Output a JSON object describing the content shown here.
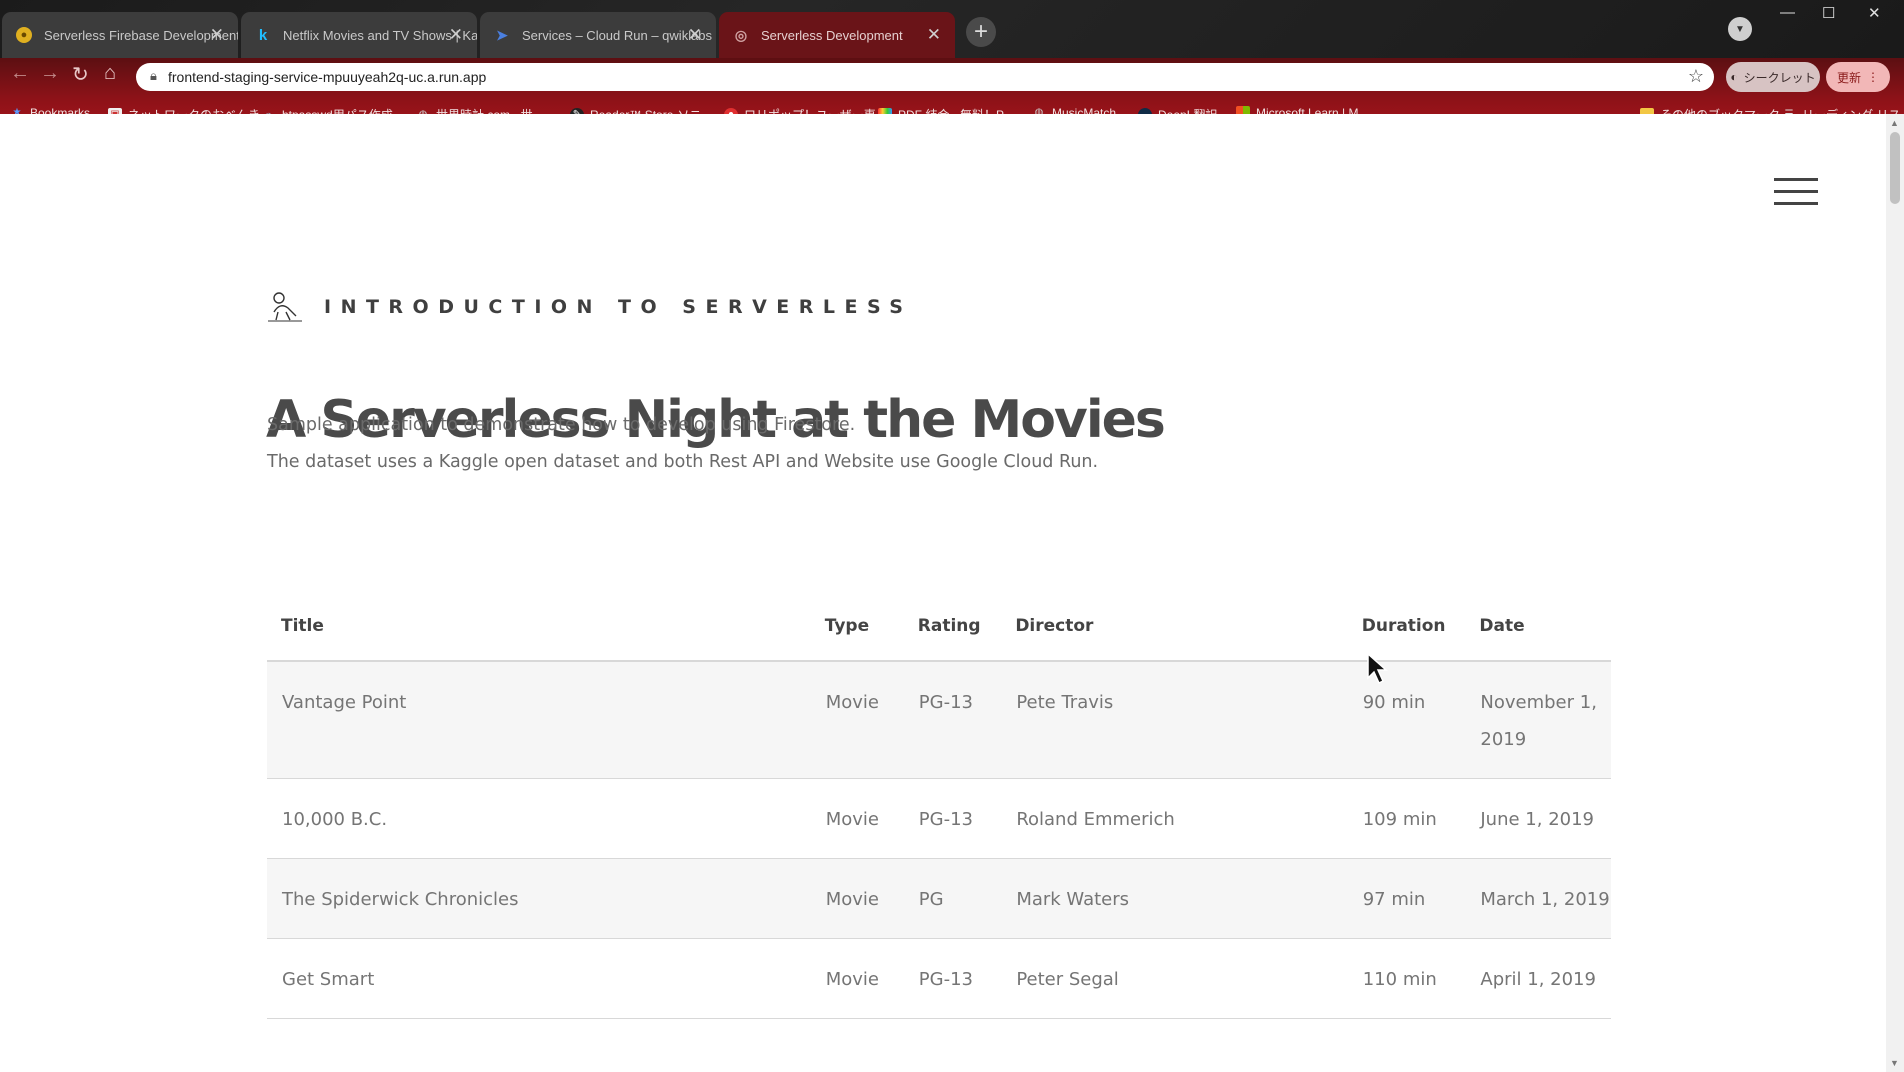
{
  "browser": {
    "tabs": [
      {
        "title": "Serverless Firebase Development",
        "favicon": "firebase-icon",
        "active": false
      },
      {
        "title": "Netflix Movies and TV Shows | Kaggle",
        "favicon": "kaggle-icon",
        "active": false
      },
      {
        "title": "Services – Cloud Run – qwiklabs",
        "favicon": "cloud-run-icon",
        "active": false
      },
      {
        "title": "Serverless Development",
        "favicon": "globe-icon",
        "active": true
      }
    ],
    "url": "frontend-staging-service-mpuuyeah2q-uc.a.run.app",
    "incognito_label": "シークレット",
    "update_label": "更新",
    "bookmarks": [
      "Bookmarks",
      "ネットワークのおべんき...",
      "htpasswd用パス作成...",
      "世界時計.com - 世...",
      "Reader™ Store-ソニ...",
      "ロリポップ！ユーザー専...",
      "PDF 結合 - 無料！P...",
      "MusicMatch",
      "DeepL翻訳",
      "Microsoft Learn | M..."
    ],
    "bookmarks_right": [
      "その他のブックマーク",
      "リーディング リスト"
    ]
  },
  "page": {
    "brand": "INTRODUCTION TO SERVERLESS",
    "title": "A Serverless Night at the Movies",
    "desc1": "Sample application to demonstrate how to develop using Firestore.",
    "desc2": "The dataset uses a Kaggle open dataset and both Rest API and Website use Google Cloud Run.",
    "table": {
      "headers": {
        "title": "Title",
        "type": "Type",
        "rating": "Rating",
        "director": "Director",
        "duration": "Duration",
        "date": "Date"
      },
      "rows": [
        {
          "title": "Vantage Point",
          "type": "Movie",
          "rating": "PG-13",
          "director": "Pete Travis",
          "duration": "90 min",
          "date": "November 1, 2019"
        },
        {
          "title": "10,000 B.C.",
          "type": "Movie",
          "rating": "PG-13",
          "director": "Roland Emmerich",
          "duration": "109 min",
          "date": "June 1, 2019"
        },
        {
          "title": "The Spiderwick Chronicles",
          "type": "Movie",
          "rating": "PG",
          "director": "Mark Waters",
          "duration": "97 min",
          "date": "March 1, 2019"
        },
        {
          "title": "Get Smart",
          "type": "Movie",
          "rating": "PG-13",
          "director": "Peter Segal",
          "duration": "110 min",
          "date": "April 1, 2019"
        }
      ]
    }
  }
}
